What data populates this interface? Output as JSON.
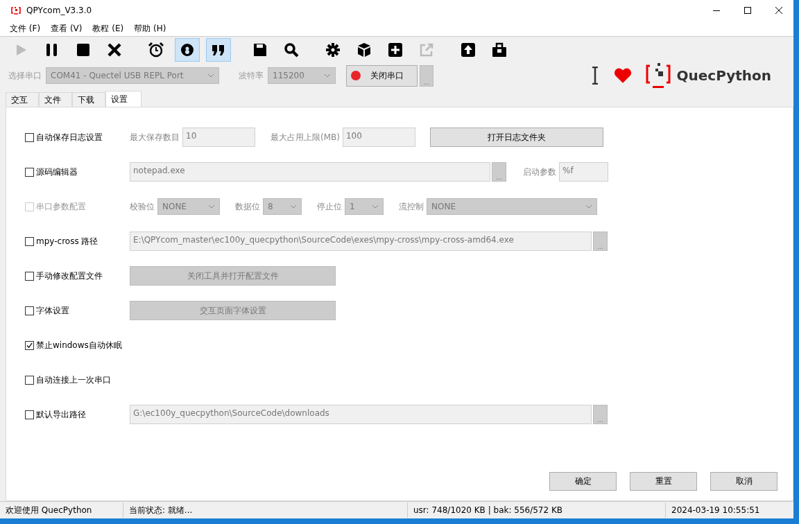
{
  "window": {
    "title": "QPYcom_V3.3.0"
  },
  "menu": [
    "文件 (F)",
    "查看 (V)",
    "教程 (E)",
    "帮助 (H)"
  ],
  "toolbar": [
    [
      {
        "kind": "play",
        "selected": false,
        "disabled": true
      },
      {
        "kind": "pause",
        "selected": false,
        "disabled": false
      },
      {
        "kind": "stop",
        "selected": false,
        "disabled": false
      },
      {
        "kind": "cross",
        "selected": false,
        "disabled": false
      }
    ],
    [
      {
        "kind": "alarm",
        "selected": false,
        "disabled": false
      },
      {
        "kind": "ring",
        "selected": true,
        "disabled": false
      },
      {
        "kind": "quote",
        "selected": true,
        "disabled": false
      }
    ],
    [
      {
        "kind": "save",
        "selected": false,
        "disabled": false
      },
      {
        "kind": "search",
        "selected": false,
        "disabled": false
      }
    ],
    [
      {
        "kind": "gear",
        "selected": false,
        "disabled": false
      },
      {
        "kind": "cube",
        "selected": false,
        "disabled": false
      },
      {
        "kind": "plus",
        "selected": false,
        "disabled": false
      },
      {
        "kind": "export",
        "selected": false,
        "disabled": true
      }
    ],
    [
      {
        "kind": "upload",
        "selected": false,
        "disabled": false
      },
      {
        "kind": "toolbox",
        "selected": false,
        "disabled": false
      }
    ]
  ],
  "port_bar": {
    "port_label": "选择串口",
    "port": "COM41 - Quectel USB REPL Port",
    "baud_label": "波特率",
    "baud": "115200",
    "disabled": true,
    "close_button": "关闭串口",
    "more_button": "...",
    "brand": "QuecPython"
  },
  "tabs": [
    {
      "label": "交互",
      "selected": false
    },
    {
      "label": "文件",
      "selected": false
    },
    {
      "label": "下载",
      "selected": false
    },
    {
      "label": "设置",
      "selected": true
    }
  ],
  "settings": [
    {
      "kind": "log",
      "label": "自动保存日志设置",
      "checked": false,
      "disabled": false,
      "count_label": "最大保存数目",
      "count": "10",
      "limit_label": "最大占用上限(MB)",
      "limit": "100",
      "button": "打开日志文件夹"
    },
    {
      "kind": "editor",
      "label": "源码编辑器",
      "checked": false,
      "disabled": false,
      "value": "notepad.exe",
      "browse": "...",
      "args_label": "启动参数",
      "args": "%f"
    },
    {
      "kind": "serial",
      "label": "串口参数配置",
      "checked": false,
      "disabled": true,
      "selects": [
        {
          "label": "校验位",
          "value": "NONE"
        },
        {
          "label": "数据位",
          "value": "8"
        },
        {
          "label": "停止位",
          "value": "1"
        },
        {
          "label": "流控制",
          "value": "NONE"
        }
      ]
    },
    {
      "kind": "path",
      "label": "mpy-cross 路径",
      "checked": false,
      "disabled": false,
      "value": "E:\\QPYcom_master\\ec100y_quecpython\\SourceCode\\exes\\mpy-cross\\mpy-cross-amd64.exe",
      "browse": "..."
    },
    {
      "kind": "action",
      "label": "手动修改配置文件",
      "checked": false,
      "disabled": false,
      "button": "关闭工具并打开配置文件"
    },
    {
      "kind": "action",
      "label": "字体设置",
      "checked": false,
      "disabled": false,
      "button": "交互页面字体设置"
    },
    {
      "kind": "plain",
      "label": "禁止windows自动休眠",
      "checked": true,
      "disabled": false
    },
    {
      "kind": "plain",
      "label": "自动连接上一次串口",
      "checked": false,
      "disabled": false
    },
    {
      "kind": "path",
      "label": "默认导出路径",
      "checked": false,
      "disabled": false,
      "value": "G:\\ec100y_quecpython\\SourceCode\\downloads",
      "browse": "..."
    }
  ],
  "buttons": [
    "确定",
    "重置",
    "取消"
  ],
  "status_bar": [
    "欢迎使用 QuecPython",
    "当前状态: 就绪...",
    "usr: 748/1020 KB | bak: 556/572 KB",
    "2024-03-19 10:55:51"
  ]
}
